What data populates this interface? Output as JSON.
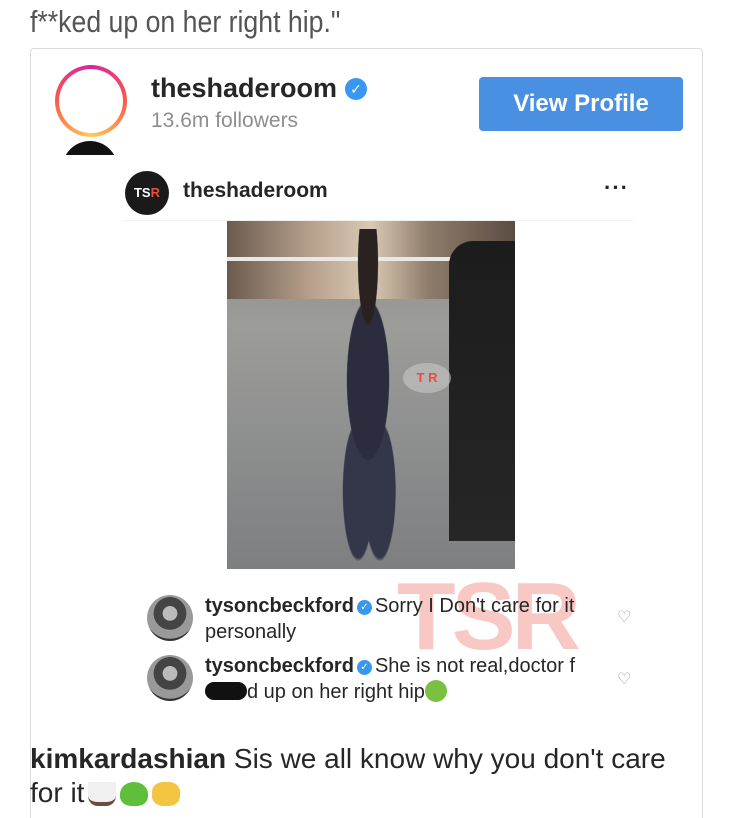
{
  "top_caption": "f**ked up on her right hip.\"",
  "profile": {
    "username": "theshaderoom",
    "followers": "13.6m followers",
    "view_profile_label": "View Profile"
  },
  "post": {
    "username": "theshaderoom",
    "avatar_text_main": "TS",
    "avatar_text_accent": "R",
    "photo_watermark": "T R"
  },
  "overlay_watermark": "TSR",
  "comments": [
    {
      "username": "tysoncbeckford",
      "text": "Sorry I Don't care for it personally"
    },
    {
      "username": "tysoncbeckford",
      "text_before": "She is not real,doctor f",
      "text_after": "d up on her right hip"
    }
  ],
  "caption": {
    "username": "kimkardashian",
    "text": "Sis we all know why you don't care for it"
  },
  "colors": {
    "button": "#4a90e2",
    "verified": "#3897f0",
    "watermark": "#e74c3c"
  }
}
